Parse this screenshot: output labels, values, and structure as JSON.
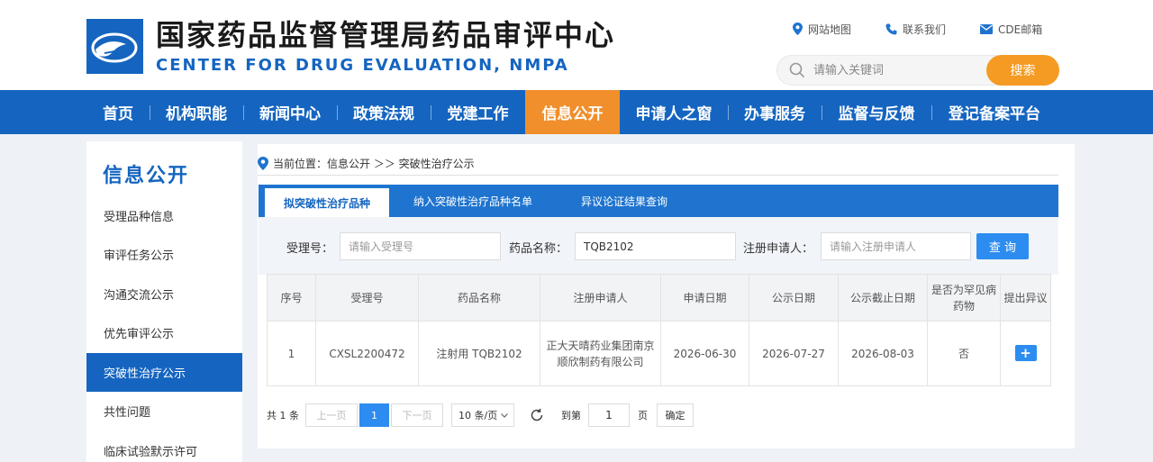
{
  "header": {
    "title": "国家药品监督管理局药品审评中心",
    "subtitle": "CENTER FOR DRUG EVALUATION, NMPA",
    "links": [
      {
        "label": "网站地图",
        "icon": "location-pin-icon"
      },
      {
        "label": "联系我们",
        "icon": "phone-icon"
      },
      {
        "label": "CDE邮箱",
        "icon": "mail-icon"
      }
    ],
    "search": {
      "placeholder": "请输入关键词",
      "value": "",
      "button": "搜索"
    }
  },
  "nav": {
    "items": [
      "首页",
      "机构职能",
      "新闻中心",
      "政策法规",
      "党建工作",
      "信息公开",
      "申请人之窗",
      "办事服务",
      "监督与反馈",
      "登记备案平台"
    ],
    "active": "信息公开"
  },
  "sidebar": {
    "title": "信息公开",
    "items": [
      "受理品种信息",
      "审评任务公示",
      "沟通交流公示",
      "优先审评公示",
      "突破性治疗公示",
      "共性问题",
      "临床试验默示许可"
    ],
    "active": "突破性治疗公示"
  },
  "breadcrumb": {
    "prefix": "当前位置：",
    "path": "信息公开 ＞＞ 突破性治疗公示"
  },
  "tabs": {
    "items": [
      "拟突破性治疗品种",
      "纳入突破性治疗品种名单",
      "异议论证结果查询"
    ],
    "active": "拟突破性治疗品种"
  },
  "filters": {
    "accept_no": {
      "label": "受理号：",
      "placeholder": "请输入受理号",
      "value": ""
    },
    "drug_name": {
      "label": "药品名称：",
      "placeholder": "",
      "value": "TQB2102"
    },
    "applicant": {
      "label": "注册申请人：",
      "placeholder": "请输入注册申请人",
      "value": ""
    },
    "query_button": "查 询"
  },
  "table": {
    "headers": [
      "序号",
      "受理号",
      "药品名称",
      "注册申请人",
      "申请日期",
      "公示日期",
      "公示截止日期",
      "是否为罕见病药物",
      "提出异议"
    ],
    "rows": [
      {
        "seq": "1",
        "accept_no": "CXSL2200472",
        "drug_name": "注射用 TQB2102",
        "applicant": "正大天晴药业集团南京顺欣制药有限公司",
        "apply_date": "2026-06-30",
        "publish_date": "2026-07-27",
        "deadline": "2026-08-03",
        "rare_disease": "否",
        "objection": "+"
      }
    ]
  },
  "pagination": {
    "total": "共 1 条",
    "prev": "上一页",
    "current": "1",
    "next": "下一页",
    "page_size": "10 条/页",
    "goto_label": "到第",
    "goto_value": "1",
    "page_unit": "页",
    "confirm": "确定"
  },
  "colors": {
    "primary": "#1565c0",
    "tab_bar": "#1e74cf",
    "accent_orange": "#f08f2b",
    "search_button": "#f59b23",
    "button_blue": "#2d8cf0"
  }
}
